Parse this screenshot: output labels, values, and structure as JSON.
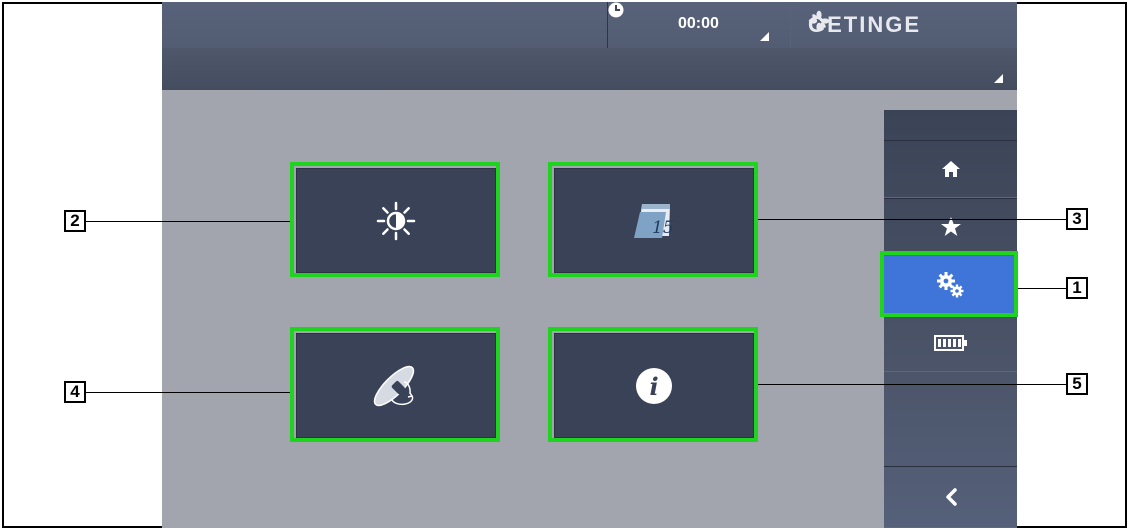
{
  "header": {
    "clock_time": "00:00",
    "brand": "GETINGE"
  },
  "sidebar": {
    "items": [
      {
        "name": "home",
        "icon": "home-icon"
      },
      {
        "name": "favorites",
        "icon": "star-icon"
      },
      {
        "name": "settings",
        "icon": "gears-icon",
        "active": true
      },
      {
        "name": "battery",
        "icon": "battery-icon"
      }
    ],
    "back_icon": "chevron-left-icon"
  },
  "tiles": [
    {
      "name": "brightness",
      "icon": "brightness-contrast-icon"
    },
    {
      "name": "date",
      "icon": "calendar-icon",
      "calendar_day": "15"
    },
    {
      "name": "positioning",
      "icon": "light-head-rotation-icon"
    },
    {
      "name": "information",
      "icon": "info-icon",
      "info_glyph": "i"
    }
  ],
  "callouts": {
    "settings": "1",
    "brightness": "2",
    "date": "3",
    "positioning": "4",
    "information": "5"
  },
  "colors": {
    "highlight": "#1ed41e",
    "active": "#3f74d8",
    "tile": "#3a4257",
    "background": "#a3a5ae"
  }
}
